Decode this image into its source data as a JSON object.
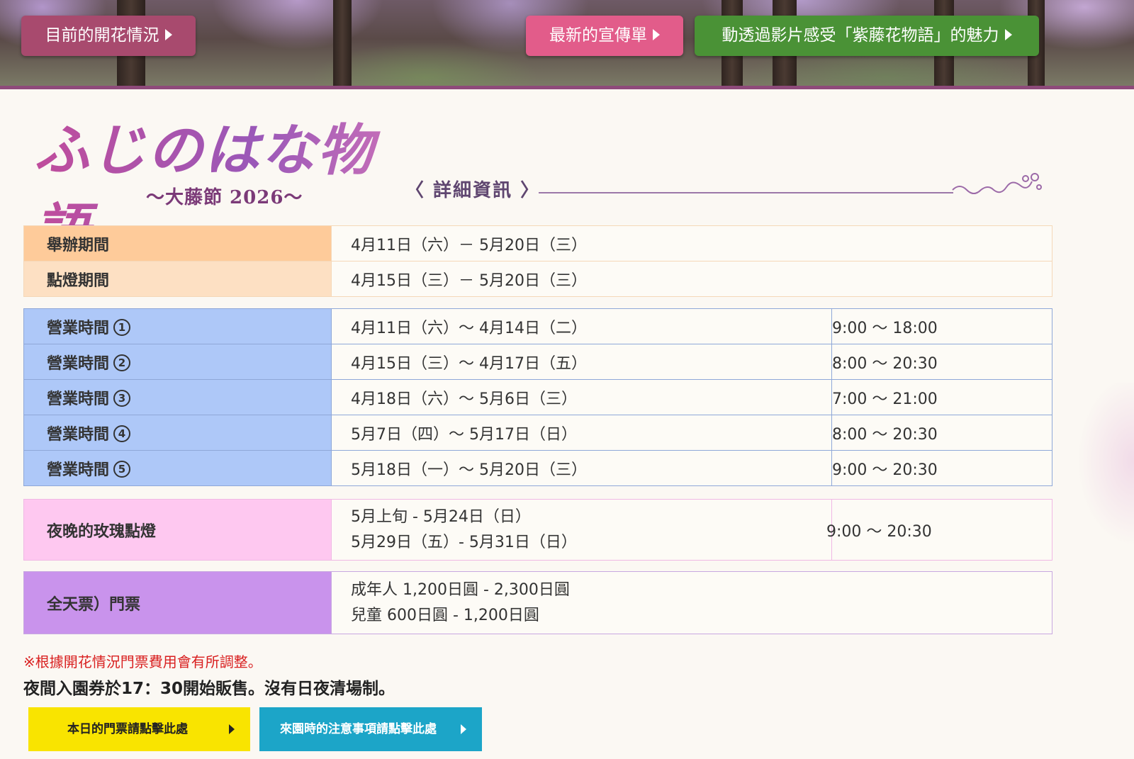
{
  "header": {
    "btn_bloom": "目前的開花情況",
    "btn_flyer": "最新的宣傳單",
    "btn_video": "動透過影片感受「紫藤花物語」的魅力",
    "colors": {
      "bloom": "#a84a6e",
      "flyer": "#e25c8a",
      "video": "#4a9236"
    }
  },
  "logo": {
    "script": "ふじのはな物語",
    "subtitle": "〜大藤節 2026〜"
  },
  "detail_heading": "〈 詳細資訊 〉",
  "period_table": [
    {
      "label": "舉辦期間",
      "value": "4月11日（六）－ 5月20日（三）"
    },
    {
      "label": "點燈期間",
      "value": "4月15日（三）－ 5月20日（三）"
    }
  ],
  "hours_table": [
    {
      "label": "營業時間",
      "num": "1",
      "dates": "4月11日（六）〜 4月14日（二）",
      "time": "9:00 〜 18:00"
    },
    {
      "label": "營業時間",
      "num": "2",
      "dates": "4月15日（三）〜 4月17日（五）",
      "time": "8:00 〜 20:30"
    },
    {
      "label": "營業時間",
      "num": "3",
      "dates": "4月18日（六）〜 5月6日（三）",
      "time": "7:00 〜 21:00"
    },
    {
      "label": "營業時間",
      "num": "4",
      "dates": "5月7日（四）〜 5月17日（日）",
      "time": "8:00 〜 20:30"
    },
    {
      "label": "營業時間",
      "num": "5",
      "dates": "5月18日（一）〜 5月20日（三）",
      "time": "9:00 〜 20:30"
    }
  ],
  "rose": {
    "label": "夜晚的玫瑰點燈",
    "line1": "5月上旬 - 5月24日（日）",
    "line2": "5月29日（五）- 5月31日（日）",
    "time": "9:00 〜 20:30"
  },
  "ticket": {
    "label": "全天票）門票",
    "line1": "成年人 1,200日圓 - 2,300日圓",
    "line2": "兒童 600日圓 - 1,200日圓"
  },
  "notes": {
    "red": "※根據開花情況門票費用會有所調整。",
    "black": "夜間入園券於17：30開始販售。沒有日夜清場制。"
  },
  "bottom": {
    "today_ticket": "本日的門票請點擊此處",
    "visit_notes": "來園時的注意事項請點擊此處"
  }
}
